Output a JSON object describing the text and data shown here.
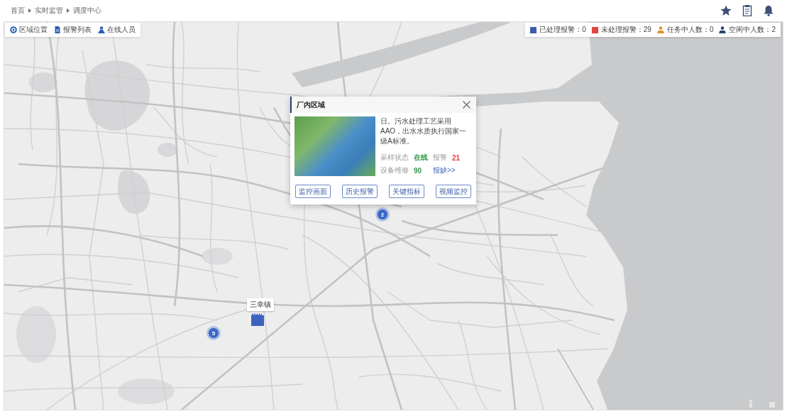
{
  "breadcrumb": [
    "首页",
    "实时监管",
    "调度中心"
  ],
  "toolbar": [
    {
      "kind": "location",
      "label": "区域位置"
    },
    {
      "kind": "document",
      "label": "报警列表"
    },
    {
      "kind": "person",
      "label": "在线人员"
    }
  ],
  "legend": [
    {
      "kind": "square",
      "color": "#3e5ea8",
      "label": "已处理报警：0"
    },
    {
      "kind": "square",
      "color": "#e2443f",
      "label": "未处理报警：29"
    },
    {
      "kind": "person",
      "color": "#e0912b",
      "label": "任务中人数：0"
    },
    {
      "kind": "person",
      "color": "#2d4373",
      "label": "空闲中人数：2"
    }
  ],
  "markers": [
    {
      "kind": "cluster",
      "count": "2"
    },
    {
      "kind": "site",
      "label": "三幸镇"
    },
    {
      "kind": "cluster",
      "count": "5"
    }
  ],
  "popup": {
    "title": "厂内区域",
    "description": "日。污水处理工艺采用AAO，出水水质执行国家一级A标准。",
    "stats": [
      {
        "label": "采样状态",
        "value": "在线",
        "color": "#3a9a4f"
      },
      {
        "label": "报警",
        "value": "21",
        "color": "#e03a3a"
      },
      {
        "label": "设备维修",
        "value": "90",
        "color": "#3a9a4f"
      }
    ],
    "link": "报缺>>",
    "buttons": [
      "监控画面",
      "历史报警",
      "关键指标",
      "视频监控"
    ]
  }
}
